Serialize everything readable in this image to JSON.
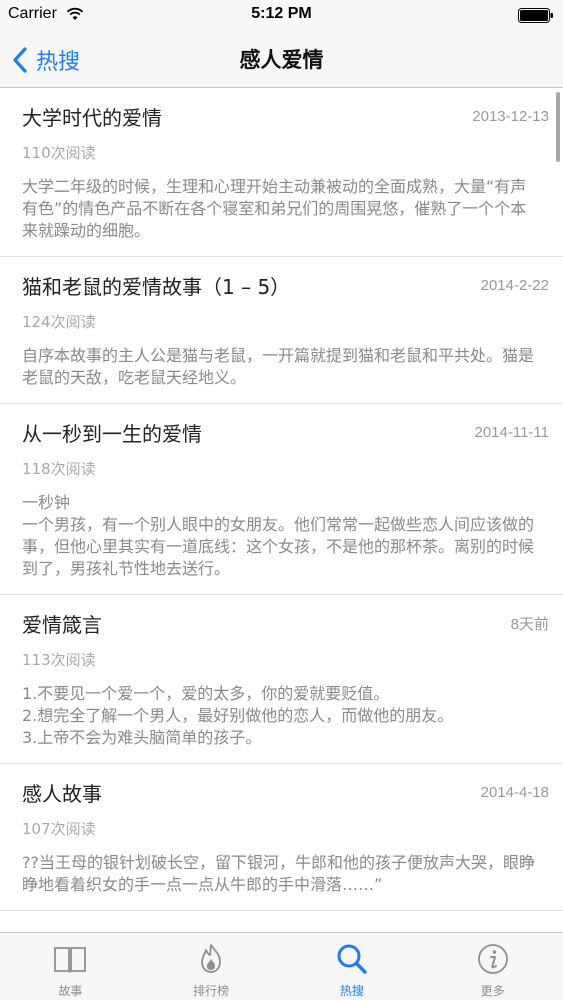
{
  "status_bar": {
    "carrier": "Carrier",
    "time": "5:12 PM"
  },
  "nav": {
    "back_label": "热搜",
    "title": "感人爱情"
  },
  "articles": [
    {
      "title": "大学时代的爱情",
      "date": "2013-12-13",
      "reads": "110次阅读",
      "excerpt": "大学二年级的时候，生理和心理开始主动兼被动的全面成熟，大量“有声有色”的情色产品不断在各个寝室和弟兄们的周围晃悠，催熟了一个个本来就躁动的细胞。"
    },
    {
      "title": "猫和老鼠的爱情故事（1 – 5）",
      "date": "2014-2-22",
      "reads": "124次阅读",
      "excerpt": "自序本故事的主人公是猫与老鼠，一开篇就提到猫和老鼠和平共处。猫是老鼠的天敌，吃老鼠天经地义。"
    },
    {
      "title": "从一秒到一生的爱情",
      "date": "2014-11-11",
      "reads": "118次阅读",
      "excerpt": "一秒钟\n一个男孩，有一个别人眼中的女朋友。他们常常一起做些恋人间应该做的事，但他心里其实有一道底线：这个女孩，不是他的那杯茶。离别的时候到了，男孩礼节性地去送行。"
    },
    {
      "title": "爱情箴言",
      "date": "8天前",
      "reads": "113次阅读",
      "excerpt": "1.不要见一个爱一个，爱的太多，你的爱就要贬值。\n2.想完全了解一个男人，最好别做他的恋人，而做他的朋友。\n3.上帝不会为难头脑简单的孩子。"
    },
    {
      "title": "感人故事",
      "date": "2014-4-18",
      "reads": "107次阅读",
      "excerpt": "??当王母的银针划破长空，留下银河，牛郎和他的孩子便放声大哭，眼睁睁地看着织女的手一点一点从牛郎的手中滑落……”"
    }
  ],
  "tabs": [
    {
      "label": "故事",
      "icon": "book-icon",
      "active": false
    },
    {
      "label": "排行榜",
      "icon": "flame-icon",
      "active": false
    },
    {
      "label": "热搜",
      "icon": "search-icon",
      "active": true
    },
    {
      "label": "更多",
      "icon": "info-icon",
      "active": false
    }
  ],
  "colors": {
    "accent": "#1a7ef5",
    "inactive": "#8e8e93",
    "bar_background": "#f7f7f8"
  }
}
